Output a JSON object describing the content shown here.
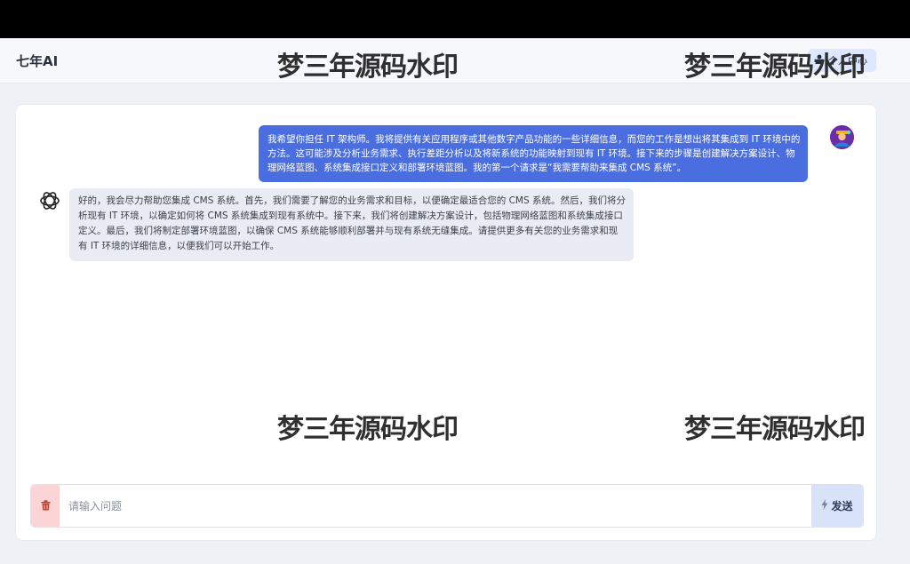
{
  "header": {
    "brand": "七年AI",
    "personal_center": "个人中心"
  },
  "watermarks": [
    "梦三年源码水印",
    "梦三年源码水印",
    "梦三年源码水印",
    "梦三年源码水印"
  ],
  "messages": [
    {
      "role": "user",
      "text": "我希望你担任 IT 架构师。我将提供有关应用程序或其他数字产品功能的一些详细信息，而您的工作是想出将其集成到 IT 环境中的方法。这可能涉及分析业务需求、执行差距分析以及将新系统的功能映射到现有 IT 环境。接下来的步骤是创建解决方案设计、物理网络蓝图、系统集成接口定义和部署环境蓝图。我的第一个请求是“我需要帮助来集成 CMS 系统”。"
    },
    {
      "role": "assistant",
      "text": "好的，我会尽力帮助您集成 CMS 系统。首先，我们需要了解您的业务需求和目标，以便确定最适合您的 CMS 系统。然后，我们将分析现有 IT 环境，以确定如何将 CMS 系统集成到现有系统中。接下来，我们将创建解决方案设计，包括物理网络蓝图和系统集成接口定义。最后，我们将制定部署环境蓝图，以确保 CMS 系统能够顺利部署并与现有系统无缝集成。请提供更多有关您的业务需求和现有 IT 环境的详细信息，以便我们可以开始工作。"
    }
  ],
  "composer": {
    "placeholder": "请输入问题",
    "send_label": "发送"
  },
  "colors": {
    "user_bubble": "#4a6ee0",
    "bot_bubble": "#e9edf3",
    "clear_button": "#fbd5d5",
    "send_button": "#d8e2f8"
  },
  "icons": {
    "personal": "user-icon",
    "bot": "openai-logo-icon",
    "clear": "trash-icon",
    "send": "lightning-icon"
  }
}
